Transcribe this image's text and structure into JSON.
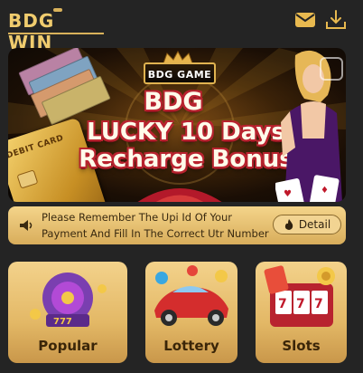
{
  "header": {
    "logo_text": "BDG WIN",
    "icons": [
      "mail-icon",
      "download-icon"
    ]
  },
  "banner": {
    "badge_text": "BDG GAME",
    "card_label": "DEBIT CARD",
    "line1": "BDG",
    "line2": "LUCKY 10 Days",
    "line3": "Recharge Bonus"
  },
  "notice": {
    "text": "Please Remember The Upi Id Of Your Payment And Fill In The Correct Utr Number And",
    "detail_label": "Detail"
  },
  "categories": [
    {
      "label": "Popular",
      "icon": "popular-icon"
    },
    {
      "label": "Lottery",
      "icon": "lottery-icon"
    },
    {
      "label": "Slots",
      "icon": "slots-icon"
    }
  ],
  "colors": {
    "background": "#242424",
    "gold": "#f0cc6e",
    "tile_top": "#f3d28b",
    "tile_bottom": "#c9974a",
    "promo_outline": "#b8232f"
  }
}
